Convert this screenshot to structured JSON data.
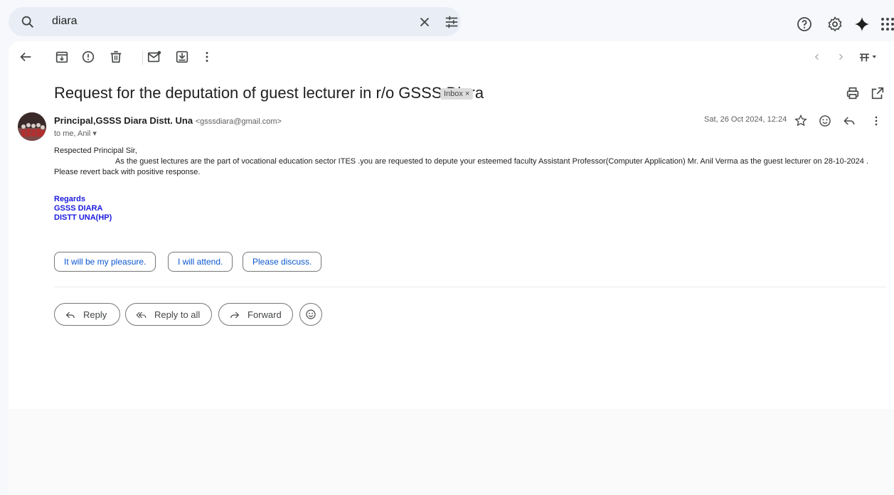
{
  "search": {
    "query": "diara"
  },
  "email": {
    "subject": "Request for the deputation of guest lecturer in r/o GSSS Diara",
    "label": "Inbox",
    "label_close": "×",
    "sender_name": "Principal,GSSS Diara Distt. Una",
    "sender_email": "<gsssdiara@gmail.com>",
    "recipients": "to me, Anil",
    "date": "Sat, 26 Oct 2024, 12:24",
    "greeting": "Respected Principal  Sir,",
    "body": "As the guest lectures are the part of vocational education sector ITES .you are requested to depute your esteemed faculty Assistant Professor(Computer Application) Mr. Anil Verma as the guest lecturer on 28-10-2024 . Please revert back with positive response.",
    "signature": [
      "Regards",
      "GSSS DIARA",
      "DISTT UNA(HP)"
    ]
  },
  "smart_replies": [
    "It will be my pleasure.",
    "I will attend.",
    "Please discuss."
  ],
  "actions": {
    "reply": "Reply",
    "reply_all": "Reply to all",
    "forward": "Forward"
  },
  "colors": {
    "accent": "#0b57d0",
    "signature": "#1a1adf",
    "search_bg": "#e9eef6",
    "gemini": "#1f1f1f"
  }
}
